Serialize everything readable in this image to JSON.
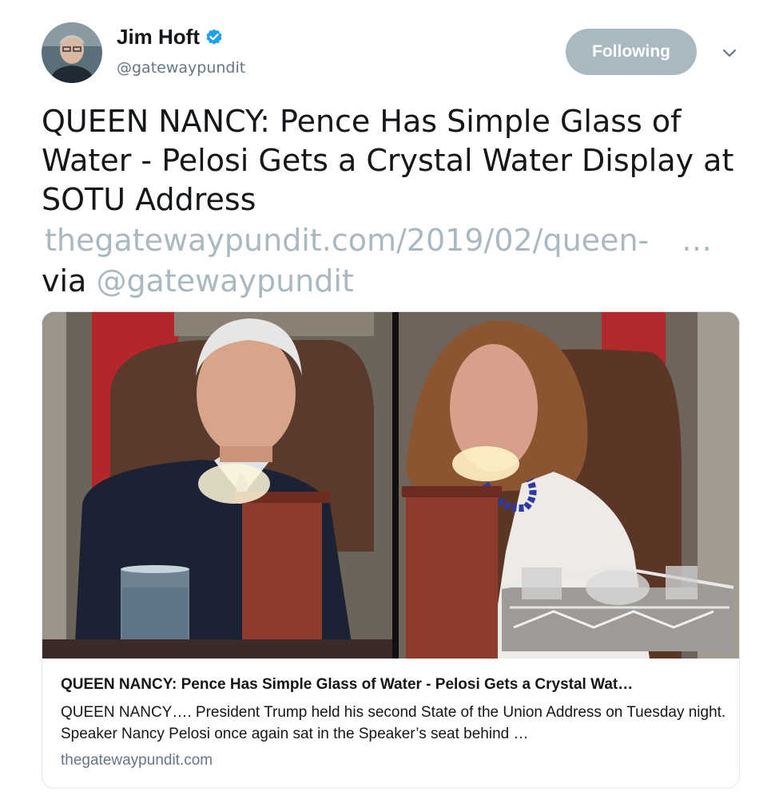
{
  "author": {
    "display_name": "Jim Hoft",
    "handle": "@gatewaypundit",
    "verified": true,
    "avatar_icon": "user-avatar"
  },
  "follow_button": {
    "label": "Following",
    "color": "#aab8c2"
  },
  "menu": {
    "icon": "chevron-down-icon"
  },
  "tweet": {
    "text": "QUEEN NANCY: Pence Has Simple Glass of Water - Pelosi Gets a Crystal Water Display at SOTU Address",
    "link_text": "thegatewaypundit.com/2019/02/queen-",
    "link_ellipsis": "…",
    "via_label": "via",
    "via_handle": "@gatewaypundit"
  },
  "card": {
    "image_description_icon": "photo-image",
    "title": "QUEEN NANCY: Pence Has Simple Glass of Water - Pelosi Gets a Crystal Wat…",
    "description": "QUEEN NANCY…. President Trump held his second State of the Union Address on Tuesday night. Speaker Nancy Pelosi once again sat in the Speaker’s seat behind …",
    "domain": "thegatewaypundit.com"
  },
  "colors": {
    "text": "#14171a",
    "muted": "#657786",
    "link_light": "#aab8c2",
    "verified": "#1da1f2",
    "border": "#e1e8ed"
  }
}
